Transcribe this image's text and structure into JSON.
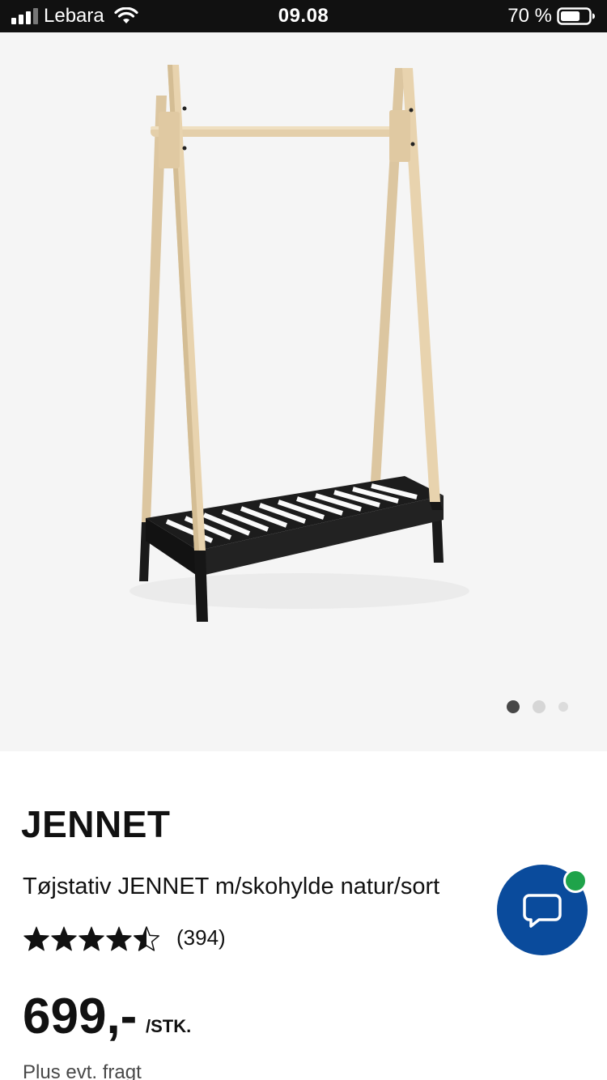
{
  "status_bar": {
    "carrier": "Lebara",
    "time": "09.08",
    "battery_percent": "70 %",
    "battery_level": 0.7,
    "signal_icon": "signal-bars-icon",
    "wifi_icon": "wifi-icon",
    "battery_icon": "battery-icon"
  },
  "gallery": {
    "image_icon": "clothes-rack-product-image",
    "active_index": 0,
    "dot_count": 3
  },
  "product": {
    "name": "JENNET",
    "description": "Tøjstativ JENNET m/skohylde natur/sort",
    "rating_value": 4.5,
    "rating_max": 5,
    "review_count": "(394)",
    "price": "699,-",
    "price_unit": "/STK.",
    "shipping_note": "Plus evt. fragt"
  },
  "chat": {
    "icon": "chat-bubble-icon",
    "online_badge_color": "#1fa34a",
    "button_color": "#0a4b9c"
  }
}
